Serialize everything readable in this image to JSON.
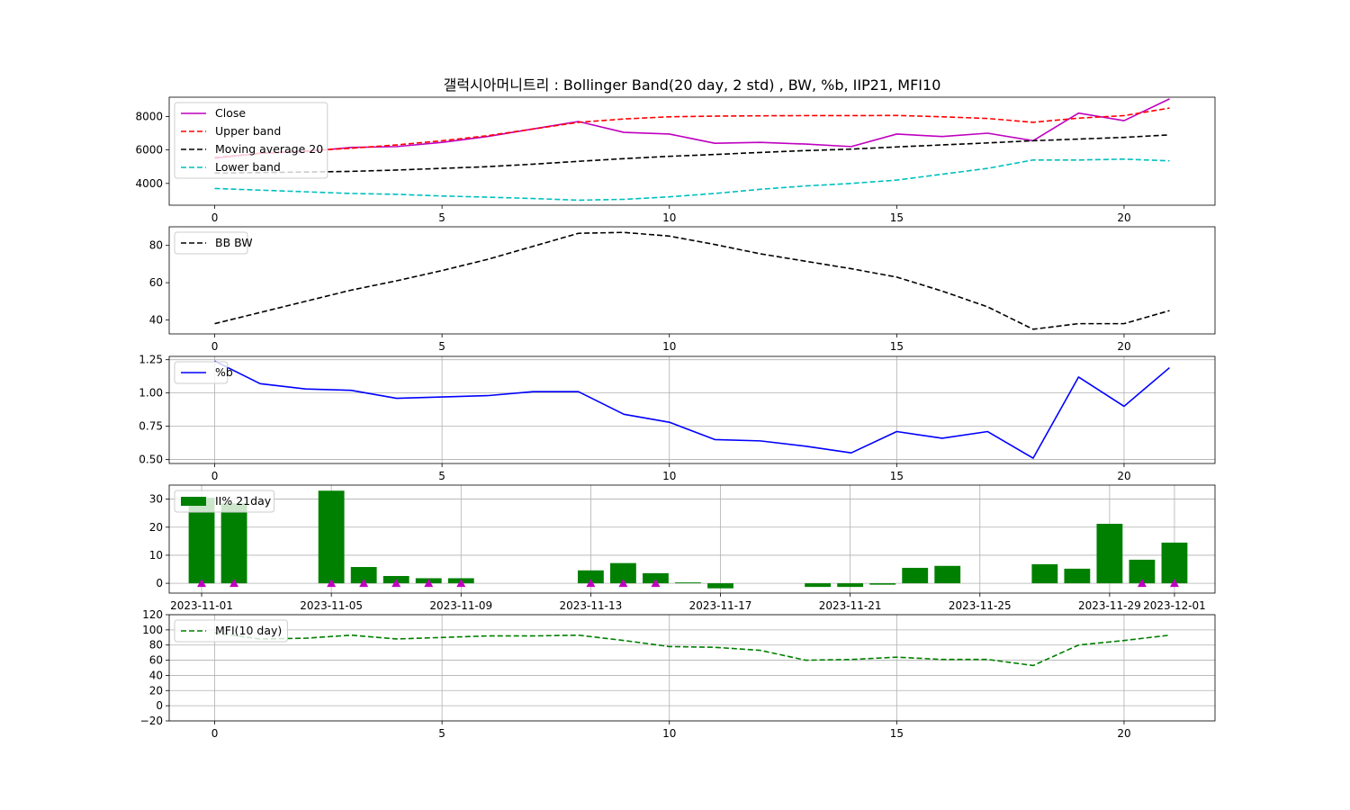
{
  "title": "갤럭시아머니트리 : Bollinger Band(20 day, 2 std) , BW, %b, IIP21, MFI10",
  "chart_data": [
    {
      "type": "line",
      "x": [
        0,
        1,
        2,
        3,
        4,
        5,
        6,
        7,
        8,
        9,
        10,
        11,
        12,
        13,
        14,
        15,
        16,
        17,
        18,
        19,
        20,
        21
      ],
      "series": [
        {
          "name": "Close",
          "color": "#bf00bf",
          "style": "solid",
          "values": [
            5500,
            5800,
            5900,
            6150,
            6200,
            6450,
            6800,
            7250,
            7700,
            7050,
            6950,
            6400,
            6450,
            6350,
            6200,
            6950,
            6800,
            7000,
            6550,
            8200,
            7750,
            9050
          ]
        },
        {
          "name": "Upper band",
          "color": "#ff0000",
          "style": "dashed",
          "values": [
            5550,
            5800,
            5950,
            6100,
            6300,
            6550,
            6850,
            7250,
            7650,
            7850,
            7980,
            8020,
            8040,
            8050,
            8050,
            8060,
            7980,
            7880,
            7650,
            7900,
            8050,
            8500
          ]
        },
        {
          "name": "Moving average 20",
          "color": "#000000",
          "style": "dashed",
          "values": [
            4620,
            4650,
            4680,
            4720,
            4800,
            4900,
            5000,
            5150,
            5320,
            5480,
            5620,
            5730,
            5850,
            5960,
            6050,
            6180,
            6300,
            6420,
            6550,
            6650,
            6750,
            6900
          ]
        },
        {
          "name": "Lower band",
          "color": "#00bfbf",
          "style": "dashed",
          "values": [
            3700,
            3600,
            3500,
            3400,
            3350,
            3250,
            3180,
            3100,
            3000,
            3050,
            3200,
            3400,
            3650,
            3850,
            4000,
            4200,
            4550,
            4900,
            5400,
            5400,
            5450,
            5350
          ]
        }
      ],
      "xlim": [
        -1,
        22
      ],
      "ylim": [
        2700,
        9150
      ],
      "xticks": [
        0,
        5,
        10,
        15,
        20
      ],
      "yticks": [
        4000,
        6000,
        8000
      ],
      "legend": "upper-left",
      "grid": false
    },
    {
      "type": "line",
      "x": [
        0,
        1,
        2,
        3,
        4,
        5,
        6,
        7,
        8,
        9,
        10,
        11,
        12,
        13,
        14,
        15,
        16,
        17,
        18,
        19,
        20,
        21
      ],
      "series": [
        {
          "name": "BB BW",
          "color": "#000000",
          "style": "dashed",
          "values": [
            38,
            44,
            50,
            56,
            61,
            66.5,
            72.5,
            79.5,
            86.5,
            87,
            85,
            80.5,
            75.5,
            71.5,
            67.5,
            63,
            55.5,
            47,
            35,
            38,
            38,
            45
          ]
        }
      ],
      "xlim": [
        -1,
        22
      ],
      "ylim": [
        32.5,
        90
      ],
      "xticks": [
        0,
        5,
        10,
        15,
        20
      ],
      "yticks": [
        40,
        60,
        80
      ],
      "legend": "upper-left",
      "grid": false
    },
    {
      "type": "line",
      "x": [
        0,
        1,
        2,
        3,
        4,
        5,
        6,
        7,
        8,
        9,
        10,
        11,
        12,
        13,
        14,
        15,
        16,
        17,
        18,
        19,
        20,
        21
      ],
      "series": [
        {
          "name": "%b",
          "color": "#0000ff",
          "style": "solid",
          "values": [
            1.24,
            1.07,
            1.03,
            1.02,
            0.96,
            0.97,
            0.98,
            1.01,
            1.01,
            0.84,
            0.78,
            0.65,
            0.64,
            0.6,
            0.55,
            0.71,
            0.66,
            0.71,
            0.51,
            1.12,
            0.9,
            1.19
          ]
        }
      ],
      "xlim": [
        -1,
        22
      ],
      "ylim": [
        0.47,
        1.275
      ],
      "xticks": [
        0,
        5,
        10,
        15,
        20
      ],
      "yticks": [
        0.5,
        0.75,
        1.0,
        1.25
      ],
      "ytick_labels": [
        "0.50",
        "0.75",
        "1.00",
        "1.25"
      ],
      "legend": "upper-left",
      "grid": true
    },
    {
      "type": "bar",
      "series": [
        {
          "name": "II% 21day",
          "color": "#008000",
          "points": [
            {
              "d": 0,
              "v": 30.5
            },
            {
              "d": 1,
              "v": 28.5
            },
            {
              "d": 4,
              "v": 33
            },
            {
              "d": 5,
              "v": 5.8
            },
            {
              "d": 6,
              "v": 2.6
            },
            {
              "d": 7,
              "v": 1.8
            },
            {
              "d": 8,
              "v": 1.8
            },
            {
              "d": 12,
              "v": 4.6
            },
            {
              "d": 13,
              "v": 7.2
            },
            {
              "d": 14,
              "v": 3.6
            },
            {
              "d": 15,
              "v": 0.3
            },
            {
              "d": 16,
              "v": -1.8
            },
            {
              "d": 19,
              "v": -1.3
            },
            {
              "d": 20,
              "v": -1.3
            },
            {
              "d": 21,
              "v": -0.5
            },
            {
              "d": 22,
              "v": 5.5
            },
            {
              "d": 23,
              "v": 6.2
            },
            {
              "d": 26,
              "v": 6.8
            },
            {
              "d": 27,
              "v": 5.2
            },
            {
              "d": 28,
              "v": 21.2
            },
            {
              "d": 29,
              "v": 8.4
            },
            {
              "d": 30,
              "v": 14.5
            }
          ]
        }
      ],
      "markers": {
        "color": "#bf00bf",
        "days": [
          0,
          1,
          4,
          5,
          6,
          7,
          8,
          12,
          13,
          14,
          29,
          30
        ]
      },
      "start_date": "2023-11-01",
      "xlim": [
        -1.0,
        31.25
      ],
      "ylim": [
        -3.5,
        35
      ],
      "xticks": [
        0,
        4,
        8,
        12,
        16,
        20,
        24,
        28,
        30
      ],
      "xtick_labels": [
        "2023-11-01",
        "2023-11-05",
        "2023-11-09",
        "2023-11-13",
        "2023-11-17",
        "2023-11-21",
        "2023-11-25",
        "2023-11-29",
        "2023-12-01"
      ],
      "yticks": [
        0,
        10,
        20,
        30
      ],
      "legend": "upper-left",
      "grid": true
    },
    {
      "type": "line",
      "x": [
        0,
        1,
        2,
        3,
        4,
        5,
        6,
        7,
        8,
        9,
        10,
        11,
        12,
        13,
        14,
        15,
        16,
        17,
        18,
        19,
        20,
        21
      ],
      "series": [
        {
          "name": "MFI(10 day)",
          "color": "#008000",
          "style": "dashed",
          "values": [
            96,
            88,
            89,
            93,
            88,
            90,
            92,
            92,
            93,
            86,
            78,
            77,
            73,
            60,
            61,
            64,
            61,
            61,
            53,
            80,
            86,
            93
          ]
        }
      ],
      "xlim": [
        -1,
        22
      ],
      "ylim": [
        -20,
        120
      ],
      "xticks": [
        0,
        5,
        10,
        15,
        20
      ],
      "yticks": [
        -20,
        0,
        20,
        40,
        60,
        80,
        100,
        120
      ],
      "ytick_labels": [
        "−20",
        "0",
        "20",
        "40",
        "60",
        "80",
        "100",
        "120"
      ],
      "legend": "upper-left",
      "grid": true
    }
  ]
}
